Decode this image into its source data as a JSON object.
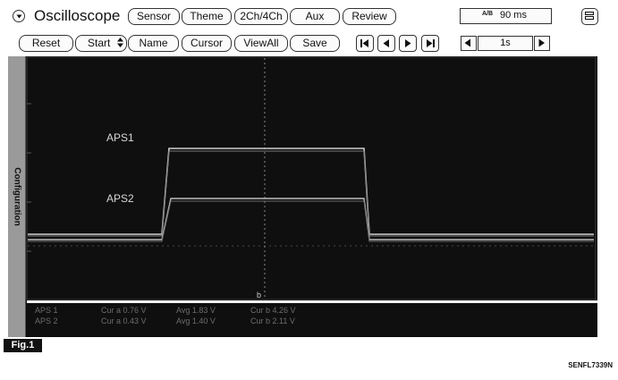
{
  "header": {
    "title": "Oscilloscope",
    "tabs": [
      "Sensor",
      "Theme",
      "2Ch/4Ch",
      "Aux",
      "Review"
    ],
    "timebase": {
      "icon": "A/B",
      "value": "90 ms"
    }
  },
  "toolbar": {
    "reset": "Reset",
    "start": "Start",
    "name": "Name",
    "cursor": "Cursor",
    "viewall": "ViewAll",
    "save": "Save",
    "time_scale": "1s"
  },
  "sidebar": {
    "label": "Configuration"
  },
  "scope": {
    "traces": [
      {
        "name": "APS1"
      },
      {
        "name": "APS2"
      }
    ],
    "cursor_marker": "b"
  },
  "readout": {
    "rows": [
      {
        "ch": "APS 1",
        "cur_a": "Cur a  0.76 V",
        "avg": "Avg  1.83 V",
        "cur_b": "Cur b  4.26 V"
      },
      {
        "ch": "APS 2",
        "cur_a": "Cur a  0.43 V",
        "avg": "Avg  1.40 V",
        "cur_b": "Cur b  2.11 V"
      }
    ]
  },
  "figure": {
    "label": "Fig.1",
    "code": "SENFL7339N"
  },
  "colors": {
    "panel": "#0f0f0f",
    "trace": "#d8d8d8",
    "readout_text": "#6d6d6d"
  }
}
